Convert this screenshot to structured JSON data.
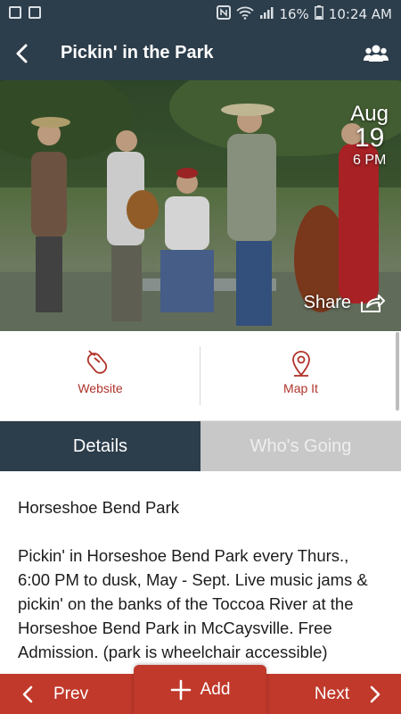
{
  "status_bar": {
    "left_icons": [
      "image-icon",
      "sim-icon"
    ],
    "right_icons": [
      "nfc-icon",
      "wifi-icon",
      "signal-icon"
    ],
    "battery": "16%",
    "time": "10:24 AM"
  },
  "header": {
    "title": "Pickin' in the Park",
    "back_icon": "chevron-left-icon",
    "group_icon": "people-icon"
  },
  "event": {
    "date": {
      "month": "Aug",
      "day": "19",
      "time": "6 PM"
    },
    "share_label": "Share",
    "share_icon": "share-arrow-icon"
  },
  "actions": {
    "website_label": "Website",
    "website_icon": "mouse-icon",
    "map_label": "Map It",
    "map_icon": "map-pin-icon"
  },
  "tabs": {
    "details": "Details",
    "whos_going": "Who's Going",
    "active": "details"
  },
  "details": {
    "venue": "Horseshoe Bend Park",
    "description": "Pickin' in Horseshoe Bend Park every Thurs., 6:00 PM to dusk, May - Sept. Live music jams & pickin' on the banks of the Toccoa River at the Horseshoe Bend Park in McCaysville. Free Admission. (park is wheelchair accessible)"
  },
  "bottom_bar": {
    "prev_label": "Prev",
    "add_label": "Add",
    "next_label": "Next"
  },
  "colors": {
    "primary_dark": "#2c3d4b",
    "accent_red": "#c0392b",
    "tab_inactive": "#c8c8c8"
  }
}
